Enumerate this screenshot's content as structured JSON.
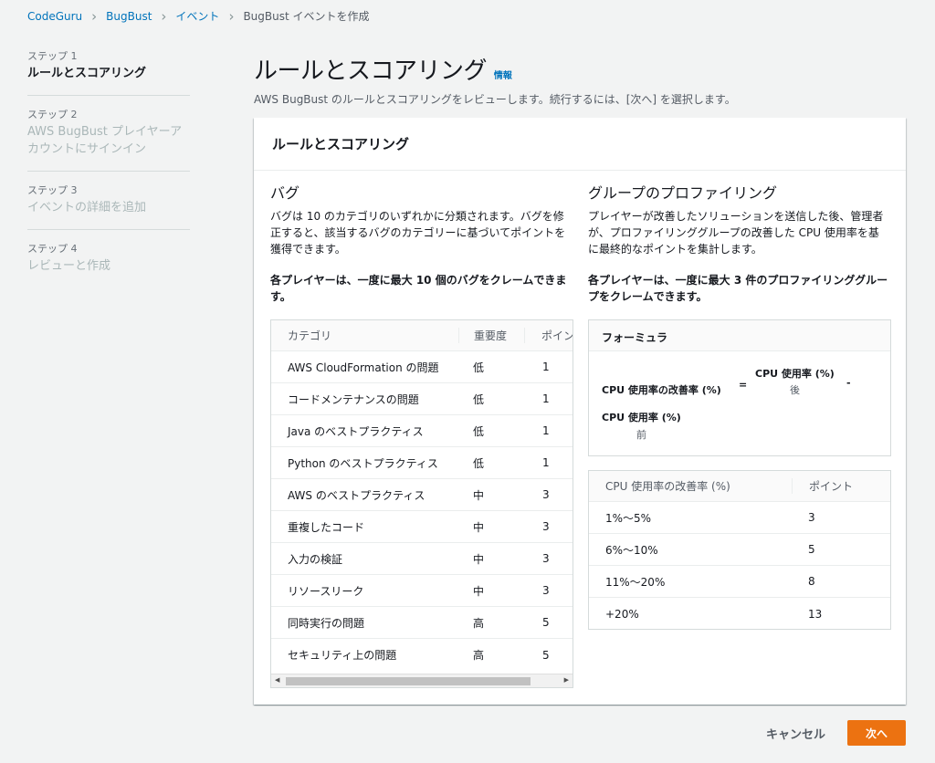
{
  "breadcrumb": [
    {
      "label": "CodeGuru",
      "link": true
    },
    {
      "label": "BugBust",
      "link": true
    },
    {
      "label": "イベント",
      "link": true
    },
    {
      "label": "BugBust イベントを作成",
      "link": false
    }
  ],
  "steps": [
    {
      "num": "ステップ 1",
      "title": "ルールとスコアリング",
      "active": true
    },
    {
      "num": "ステップ 2",
      "title": "AWS BugBust プレイヤーアカウントにサインイン",
      "active": false
    },
    {
      "num": "ステップ 3",
      "title": "イベントの詳細を追加",
      "active": false
    },
    {
      "num": "ステップ 4",
      "title": "レビューと作成",
      "active": false
    }
  ],
  "page": {
    "title": "ルールとスコアリング",
    "info": "情報",
    "description": "AWS BugBust のルールとスコアリングをレビューします。続行するには、[次へ] を選択します。"
  },
  "container": {
    "title": "ルールとスコアリング"
  },
  "bugs": {
    "heading": "バグ",
    "description": "バグは 10 のカテゴリのいずれかに分類されます。バグを修正すると、該当するバグのカテゴリーに基づいてポイントを獲得できます。",
    "bold": "各プレイヤーは、一度に最大 10 個のバグをクレームできます。",
    "columns": [
      "カテゴリ",
      "重要度",
      "ポイント"
    ],
    "rows": [
      [
        "AWS CloudFormation の問題",
        "低",
        "1"
      ],
      [
        "コードメンテナンスの問題",
        "低",
        "1"
      ],
      [
        "Java のベストプラクティス",
        "低",
        "1"
      ],
      [
        "Python のベストプラクティス",
        "低",
        "1"
      ],
      [
        "AWS のベストプラクティス",
        "中",
        "3"
      ],
      [
        "重複したコード",
        "中",
        "3"
      ],
      [
        "入力の検証",
        "中",
        "3"
      ],
      [
        "リソースリーク",
        "中",
        "3"
      ],
      [
        "同時実行の問題",
        "高",
        "5"
      ],
      [
        "セキュリティ上の問題",
        "高",
        "5"
      ]
    ]
  },
  "profiling": {
    "heading": "グループのプロファイリング",
    "description": "プレイヤーが改善したソリューションを送信した後、管理者が、プロファイリンググループの改善した CPU 使用率を基に最終的なポイントを集計します。",
    "bold": "各プレイヤーは、一度に最大 3 件のプロファイリンググループをクレームできます。",
    "formula": {
      "heading": "フォーミュラ",
      "lhs": "CPU 使用率の改善率 (%)",
      "eq": "=",
      "numerator": "CPU 使用率 (%)",
      "numerator_sub": "後",
      "minus": "-",
      "denominator": "CPU 使用率 (%)",
      "denominator_sub": "前"
    },
    "columns": [
      "CPU 使用率の改善率 (%)",
      "ポイント"
    ],
    "rows": [
      [
        "1%～5%",
        "3"
      ],
      [
        "6%～10%",
        "5"
      ],
      [
        "11%～20%",
        "8"
      ],
      [
        "+20%",
        "13"
      ]
    ]
  },
  "footer": {
    "cancel": "キャンセル",
    "next": "次へ"
  },
  "colors": {
    "accent": "#ec7211",
    "link": "#0073bb"
  }
}
